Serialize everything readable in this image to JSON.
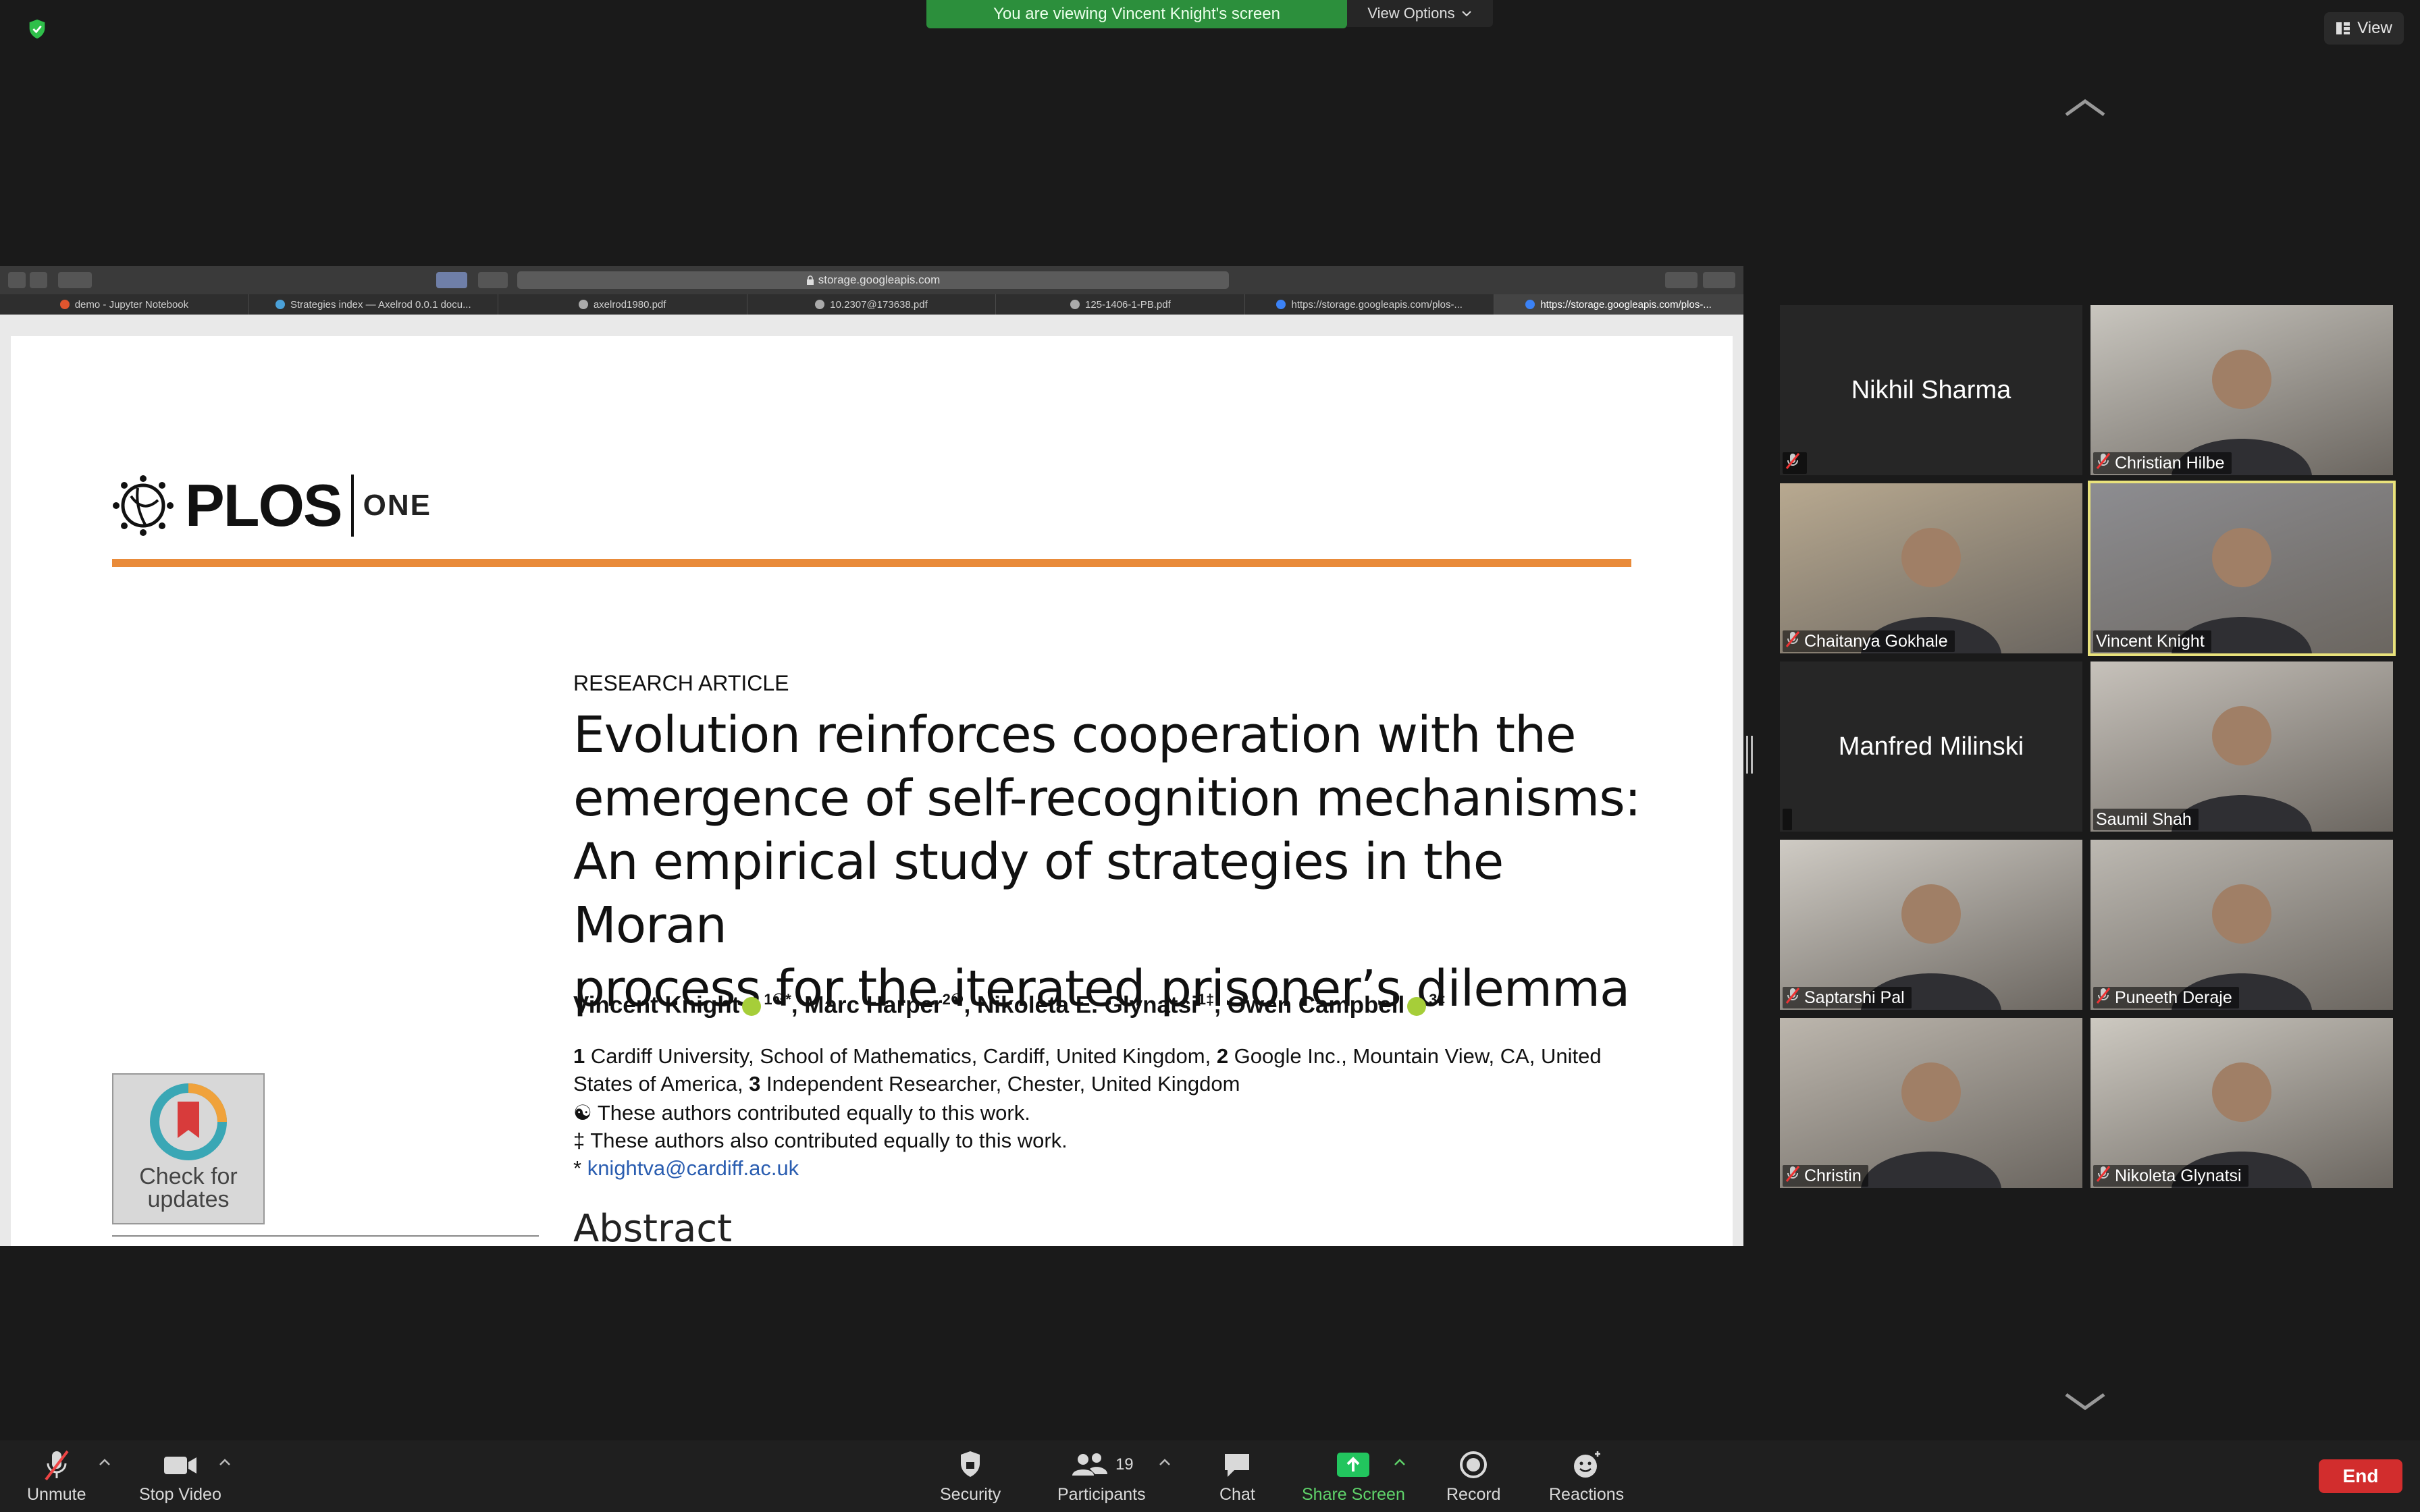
{
  "banner": {
    "text": "You are viewing Vincent Knight's screen",
    "options": "View Options"
  },
  "view_button": {
    "label": "View"
  },
  "browser": {
    "url": "storage.googleapis.com",
    "tabs": [
      {
        "label": "demo - Jupyter Notebook",
        "icon_color": "#e0552e"
      },
      {
        "label": "Strategies index — Axelrod 0.0.1 docu...",
        "icon_color": "#4aa0d8"
      },
      {
        "label": "axelrod1980.pdf",
        "icon_color": "#aaaaaa"
      },
      {
        "label": "10.2307@173638.pdf",
        "icon_color": "#aaaaaa"
      },
      {
        "label": "125-1406-1-PB.pdf",
        "icon_color": "#aaaaaa"
      },
      {
        "label": "https://storage.googleapis.com/plos-...",
        "icon_color": "#3b82f6"
      },
      {
        "label": "https://storage.googleapis.com/plos-...",
        "icon_color": "#3b82f6"
      }
    ]
  },
  "document": {
    "logo": "PLOS",
    "logo_suffix": "ONE",
    "category": "RESEARCH ARTICLE",
    "title_lines": [
      "Evolution reinforces cooperation with the",
      "emergence of self-recognition mechanisms:",
      "An empirical study of strategies in the Moran",
      "process for the iterated prisoner’s dilemma"
    ],
    "authors": {
      "a1": "Vincent Knight",
      "a1_sup": "1☯*",
      "a2": ", Marc Harper",
      "a2_sup": "2☯",
      "a3": ", Nikoleta E. Glynatsi",
      "a3_sup": "1‡",
      "a4": ", Owen Campbell",
      "a4_sup": "3‡"
    },
    "affiliations": {
      "n1": "1",
      "t1": " Cardiff University, School of Mathematics, Cardiff, United Kingdom, ",
      "n2": "2",
      "t2": " Google Inc., Mountain View, CA, United States of America, ",
      "n3": "3",
      "t3": " Independent Researcher, Chester, United Kingdom"
    },
    "notes": {
      "equal": "☯ These authors contributed equally to this work.",
      "also": "‡ These authors also contributed equally to this work.",
      "email_prefix": "* ",
      "email": "knightva@cardiff.ac.uk"
    },
    "check_updates": {
      "line1": "Check for",
      "line2": "updates"
    },
    "abstract_heading": "Abstract"
  },
  "participants": [
    {
      "name": "Nikhil Sharma",
      "video": false,
      "muted": true,
      "speaking": false
    },
    {
      "name": "Christian Hilbe",
      "video": true,
      "muted": true,
      "speaking": false,
      "bg": "#c9c6bf"
    },
    {
      "name": "Chaitanya Gokhale",
      "video": true,
      "muted": true,
      "speaking": false,
      "bg": "#b8a990"
    },
    {
      "name": "Vincent Knight",
      "video": true,
      "muted": false,
      "speaking": true,
      "bg": "#8d8d91"
    },
    {
      "name": "Manfred Milinski",
      "video": false,
      "muted": false,
      "speaking": false
    },
    {
      "name": "Saumil Shah",
      "video": true,
      "muted": false,
      "speaking": false,
      "bg": "#c7c2bb"
    },
    {
      "name": "Saptarshi Pal",
      "video": true,
      "muted": true,
      "speaking": false,
      "bg": "#cfcbc4"
    },
    {
      "name": "Puneeth Deraje",
      "video": true,
      "muted": true,
      "speaking": false,
      "bg": "#bdb9b2"
    },
    {
      "name": "Christin",
      "video": true,
      "muted": true,
      "speaking": false,
      "bg": "#bcb6ad"
    },
    {
      "name": "Nikoleta Glynatsi",
      "video": true,
      "muted": true,
      "speaking": false,
      "bg": "#cdc9c1"
    }
  ],
  "controls": {
    "unmute": "Unmute",
    "stop_video": "Stop Video",
    "security": "Security",
    "participants": "Participants",
    "participant_count": "19",
    "chat": "Chat",
    "share_screen": "Share Screen",
    "record": "Record",
    "reactions": "Reactions",
    "end": "End"
  },
  "colors": {
    "banner": "#2c8f3c",
    "speaking_border": "#e9e27b",
    "end": "#d22d2d",
    "share": "#22c55e",
    "plos_rule": "#e98b3a"
  }
}
